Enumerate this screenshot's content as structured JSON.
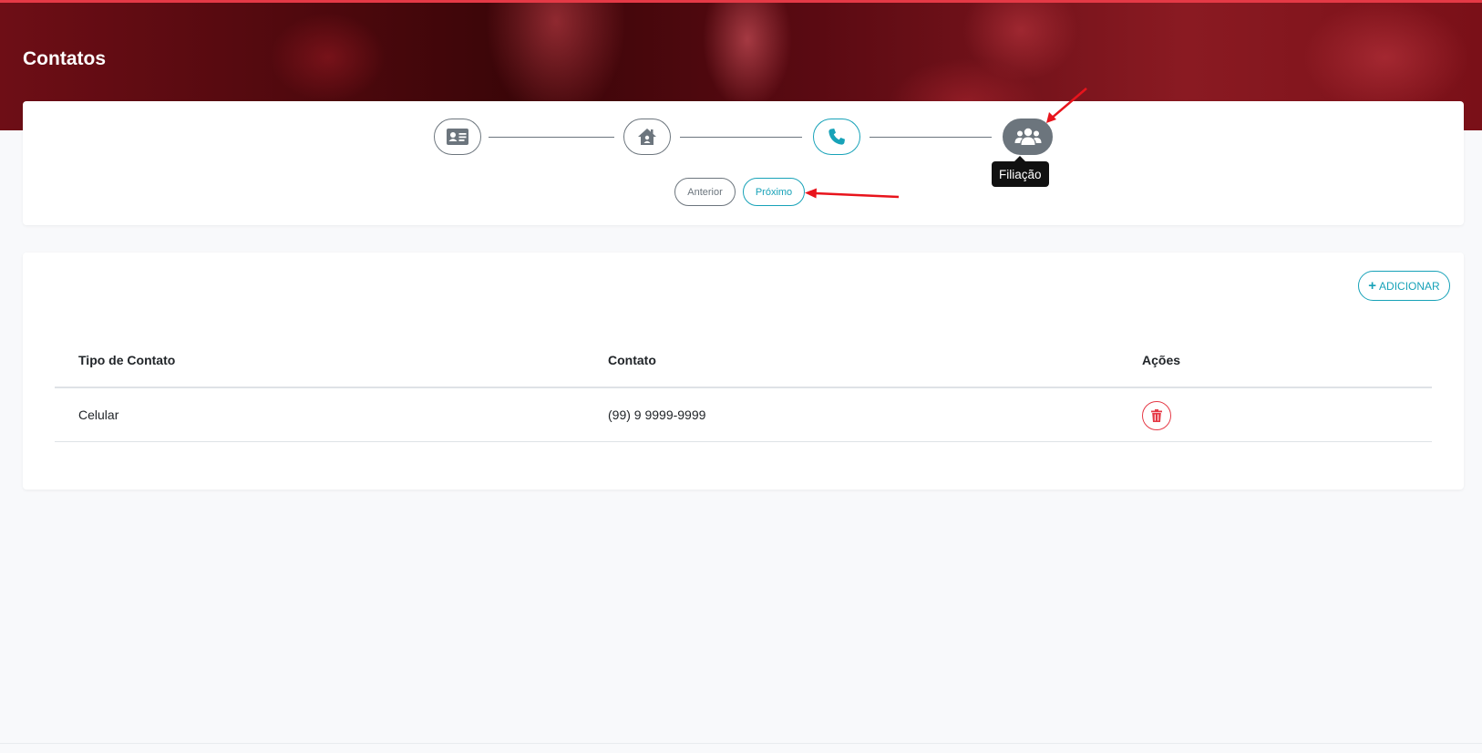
{
  "page": {
    "title": "Contatos"
  },
  "stepper": {
    "steps": [
      {
        "icon": "id-card-icon",
        "state": "done"
      },
      {
        "icon": "home-icon",
        "state": "done"
      },
      {
        "icon": "phone-icon",
        "state": "active"
      },
      {
        "icon": "users-icon",
        "state": "current",
        "tooltip": "Filiação"
      }
    ],
    "prev_label": "Anterior",
    "next_label": "Próximo"
  },
  "contacts": {
    "add_label": "ADICIONAR",
    "columns": [
      "Tipo de Contato",
      "Contato",
      "Ações"
    ],
    "rows": [
      {
        "tipo": "Celular",
        "contato": "(99) 9 9999-9999"
      }
    ]
  },
  "colors": {
    "accent": "#17a2b8",
    "muted": "#6c757d",
    "danger": "#e53946",
    "hero": "#6e0e16"
  }
}
